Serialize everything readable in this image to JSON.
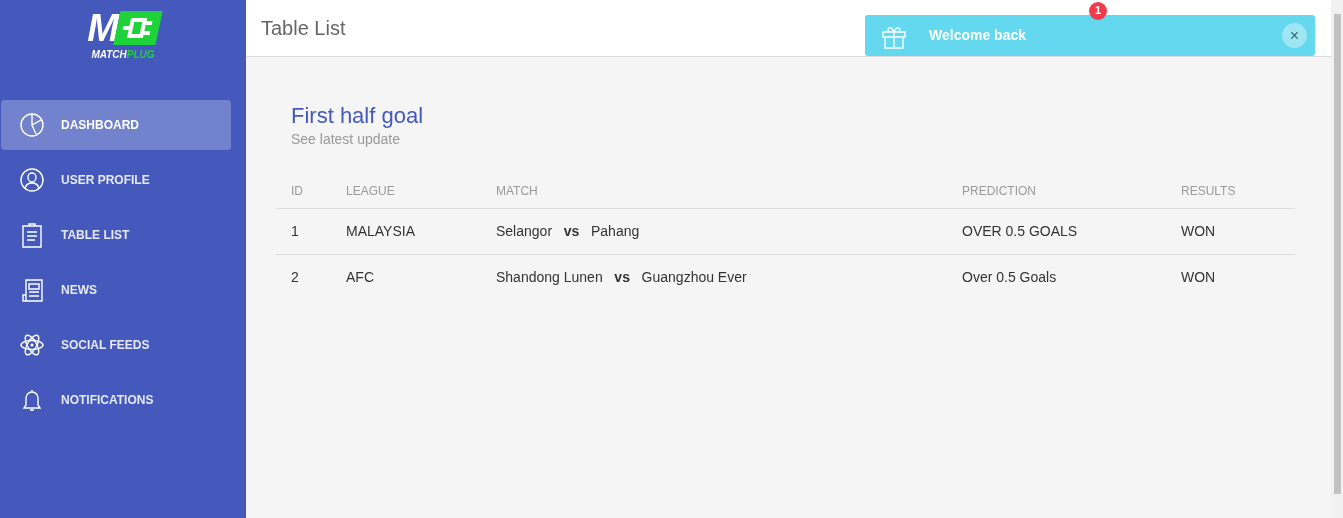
{
  "logo": {
    "mark": "M",
    "word_a": "MATCH",
    "word_b": "PLUG"
  },
  "sidebar": {
    "items": [
      {
        "label": "DASHBOARD",
        "selected": true
      },
      {
        "label": "USER PROFILE",
        "selected": false
      },
      {
        "label": "TABLE LIST",
        "selected": false
      },
      {
        "label": "NEWS",
        "selected": false
      },
      {
        "label": "SOCIAL FEEDS",
        "selected": false
      },
      {
        "label": "NOTIFICATIONS",
        "selected": false
      }
    ]
  },
  "header": {
    "title": "Table List",
    "badge": "1"
  },
  "toast": {
    "message": "Welcome back",
    "close": "×"
  },
  "card": {
    "title": "First half goal",
    "subtitle": "See latest update"
  },
  "table": {
    "columns": [
      "ID",
      "LEAGUE",
      "MATCH",
      "PREDICTION",
      "RESULTS"
    ],
    "rows": [
      {
        "id": "1",
        "league": "MALAYSIA",
        "match": "Selangor   **vs**   Pahang",
        "prediction": "OVER 0.5 GOALS",
        "result": "WON"
      },
      {
        "id": "2",
        "league": "AFC",
        "match": "Shandong Lunen   **vs**   Guangzhou Ever",
        "prediction": "Over 0.5 Goals",
        "result": "WON"
      }
    ]
  }
}
